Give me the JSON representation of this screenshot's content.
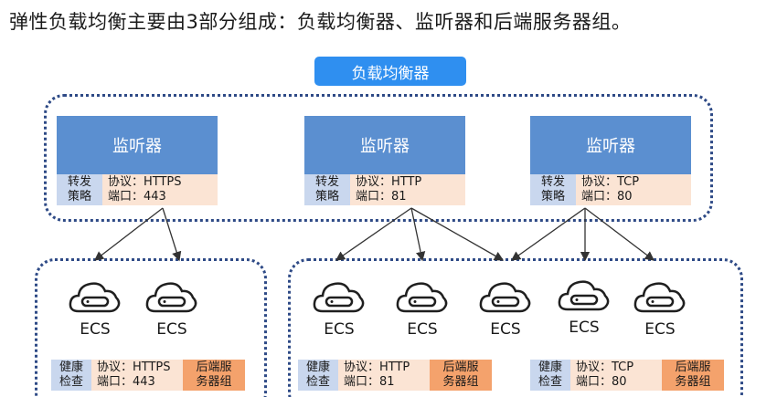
{
  "title": "弹性负载均衡主要由3部分组成：负载均衡器、监听器和后端服务器组。",
  "load_balancer_label": "负载均衡器",
  "listeners": [
    {
      "name": "监听器",
      "forward_policy": "转发\n策略",
      "protocol": "协议：HTTPS",
      "port": "端口：443"
    },
    {
      "name": "监听器",
      "forward_policy": "转发\n策略",
      "protocol": "协议：HTTP",
      "port": "端口：81"
    },
    {
      "name": "监听器",
      "forward_policy": "转发\n策略",
      "protocol": "协议：TCP",
      "port": "端口：80"
    }
  ],
  "ecs_label": "ECS",
  "health_checks": [
    {
      "label": "健康\n检查",
      "protocol": "协议：HTTPS",
      "port": "端口：443",
      "group": "后端服\n务器组"
    },
    {
      "label": "健康\n检查",
      "protocol": "协议：HTTP",
      "port": "端口：81",
      "group": "后端服\n务器组"
    },
    {
      "label": "健康\n检查",
      "protocol": "协议：TCP",
      "port": "端口：80",
      "group": "后端服\n务器组"
    }
  ],
  "colors": {
    "listener_header": "#5b8fd0",
    "policy_cell": "#c9d7ee",
    "detail_cell": "#fbe4d4",
    "group_cell": "#f4a26c",
    "load_balancer_tag": "#2f8ff0",
    "dotted_border": "#2e4a86"
  }
}
